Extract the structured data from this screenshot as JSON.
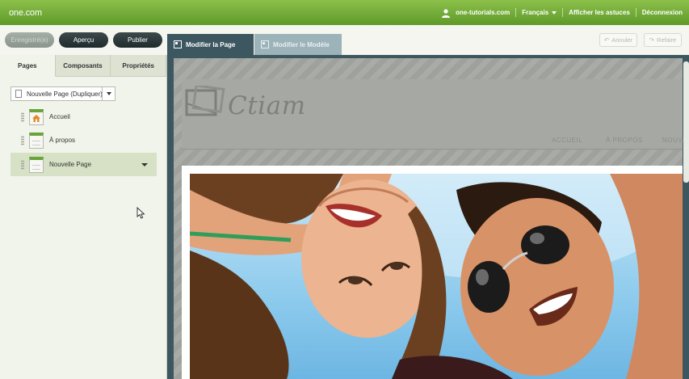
{
  "topbar": {
    "logo": "one.com",
    "account": "one-tutorials.com",
    "language": "Français",
    "tips": "Afficher les astuces",
    "logout": "Déconnexion"
  },
  "toolbar": {
    "save": "Enregistré(e)",
    "preview": "Aperçu",
    "publish": "Publier",
    "edit_page": "Modifier la Page",
    "edit_template": "Modifier le Modèle",
    "undo": "Annuler",
    "redo": "Refaire"
  },
  "left_panel": {
    "tabs": [
      "Pages",
      "Composants",
      "Propriétés"
    ],
    "page_select": "Nouvelle Page (Dupliquer)",
    "pages": [
      "Accueil",
      "À propos",
      "Nouvelle Page"
    ]
  },
  "site": {
    "logo_text": "Ctiam",
    "nav": [
      "ACCUEIL",
      "À PROPOS",
      "NOUVEL"
    ]
  },
  "colors": {
    "topbar": "#6fa836",
    "active_mode_tab": "#3d5760",
    "selected_page": "#d6e1c6"
  }
}
